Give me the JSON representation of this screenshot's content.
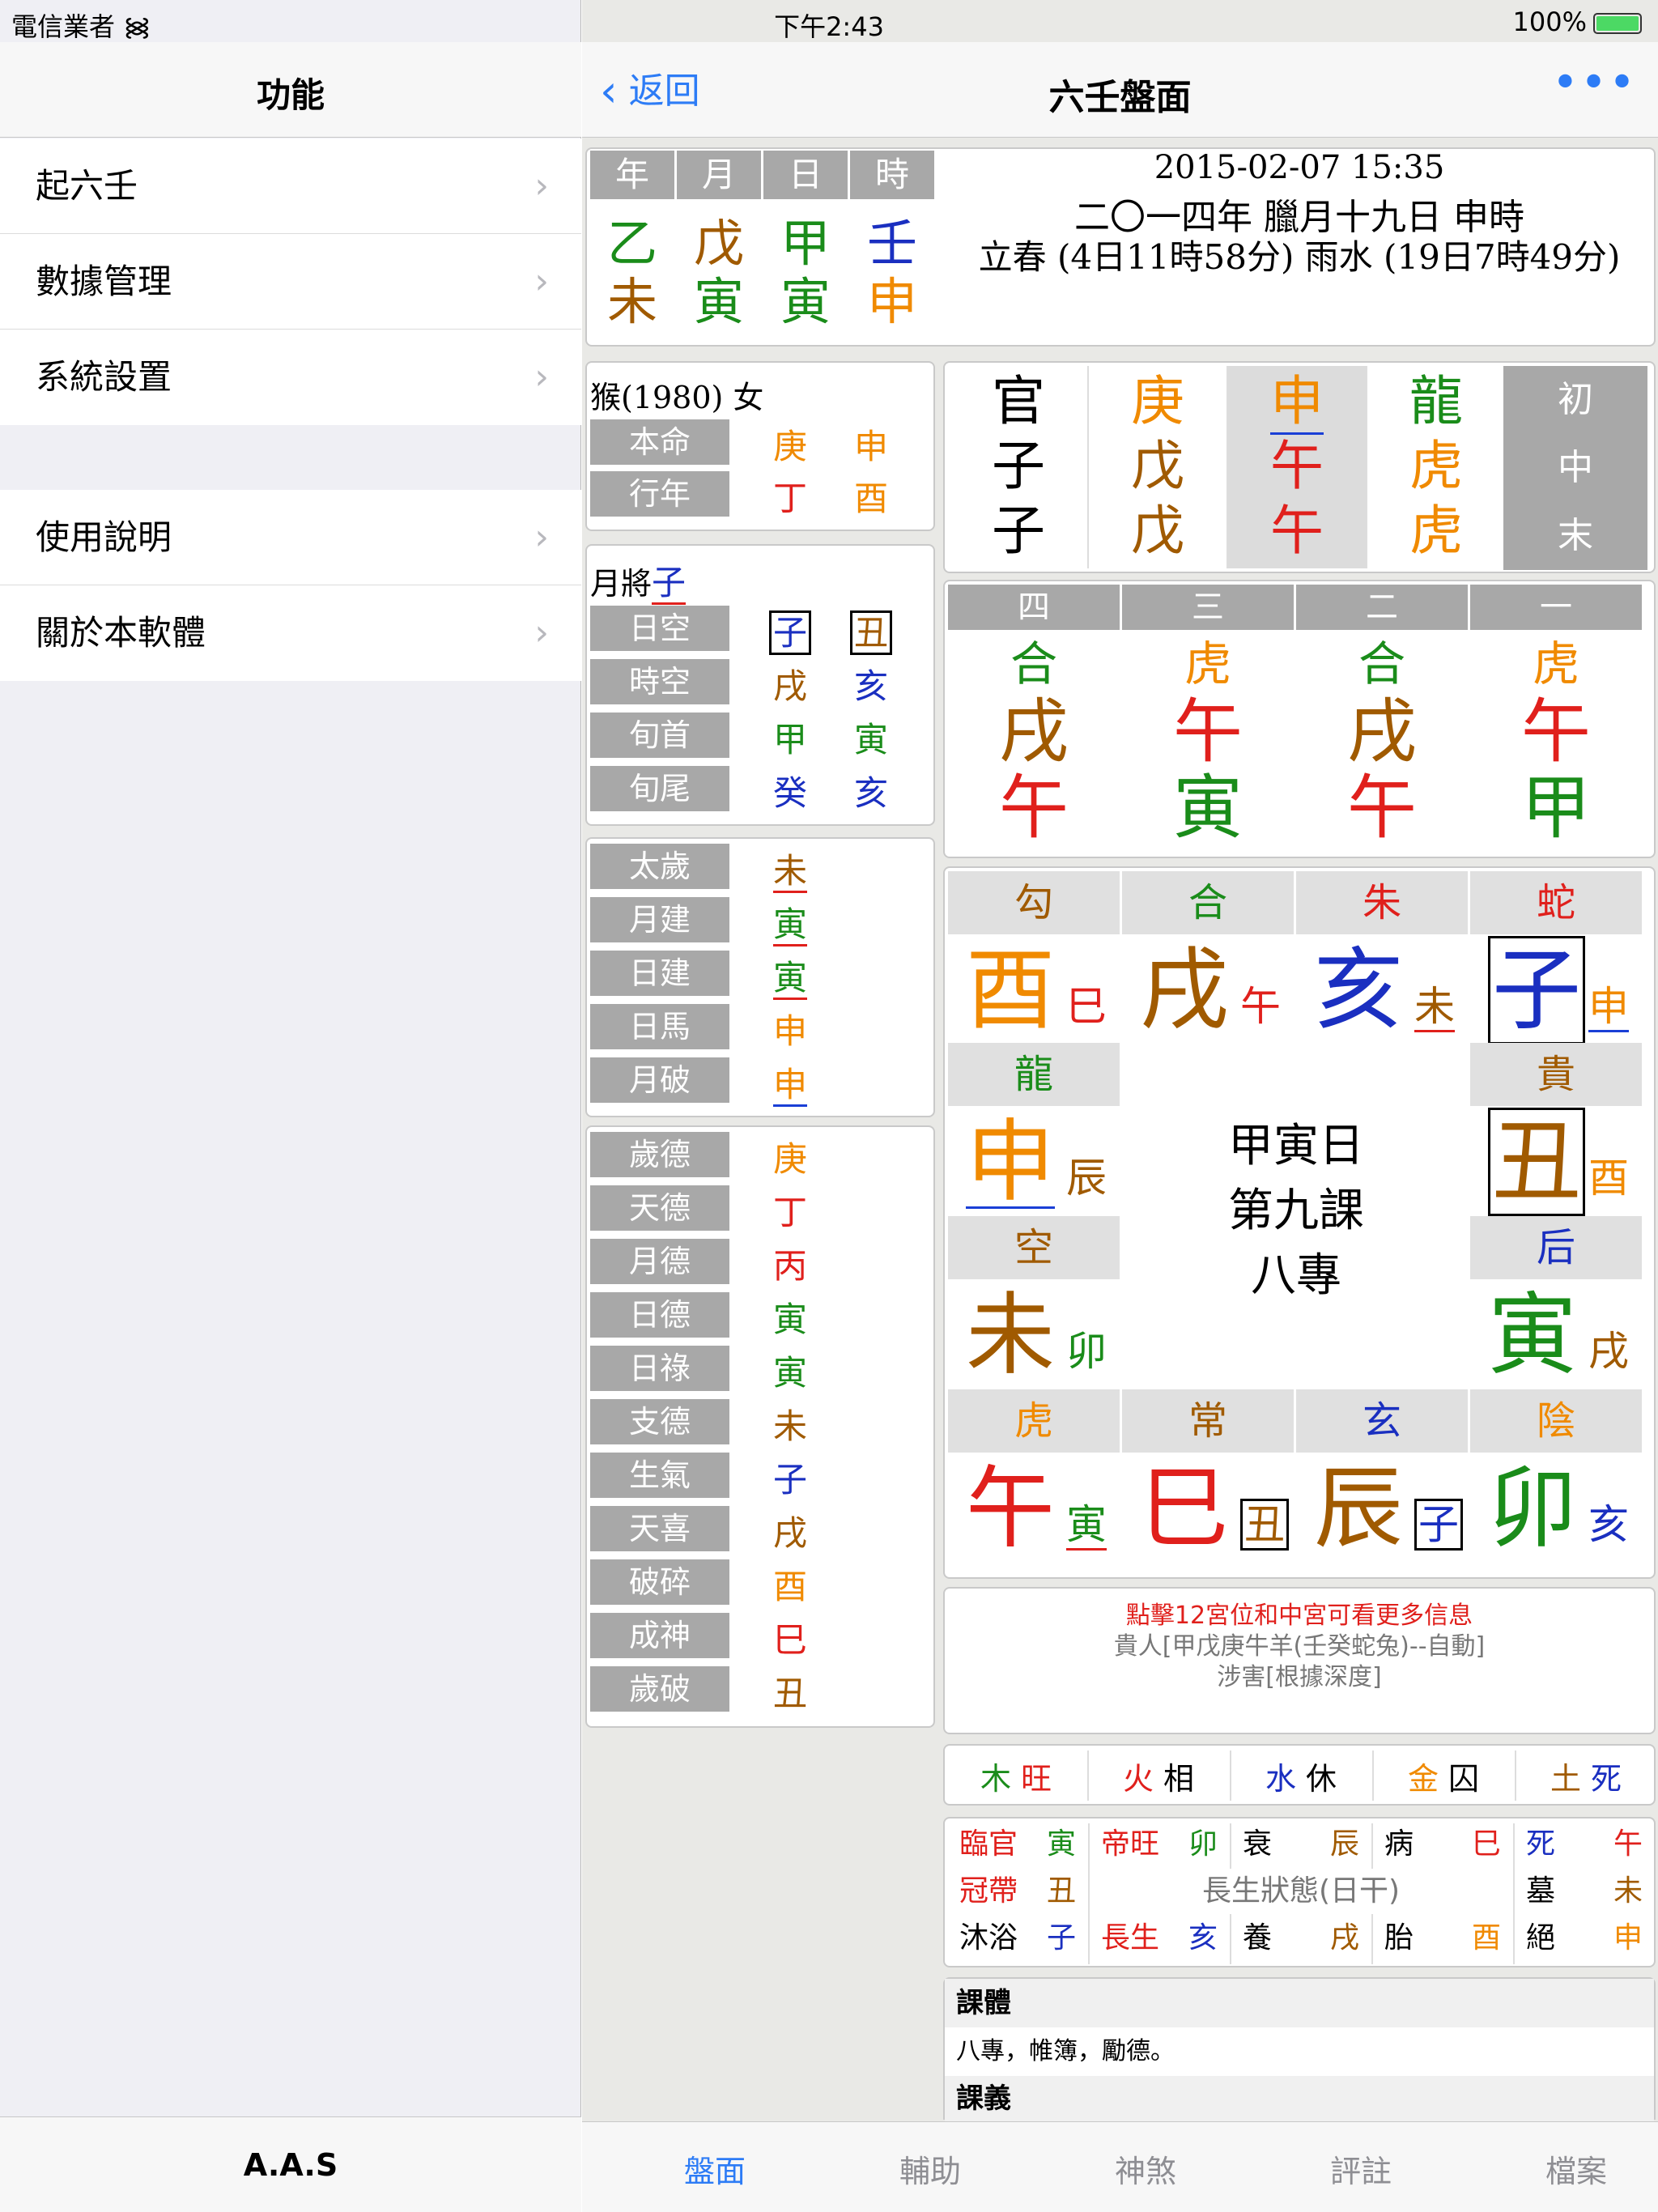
{
  "status": {
    "carrier": "電信業者",
    "time": "下午2:43",
    "battery": "100%"
  },
  "master": {
    "title": "功能",
    "group1": [
      {
        "label": "起六壬"
      },
      {
        "label": "數據管理"
      },
      {
        "label": "系統設置"
      }
    ],
    "group2": [
      {
        "label": "使用說明"
      },
      {
        "label": "關於本軟體"
      }
    ],
    "footer": "A.A.S"
  },
  "detail": {
    "back": "返回",
    "title": "六壬盤面",
    "more": "•••",
    "tabs": [
      "盤面",
      "輔助",
      "神煞",
      "評註",
      "檔案"
    ]
  },
  "pillars": {
    "headers": [
      "年",
      "月",
      "日",
      "時"
    ],
    "stems": [
      {
        "t": "乙",
        "c": "c-grn"
      },
      {
        "t": "戊",
        "c": "c-brn"
      },
      {
        "t": "甲",
        "c": "c-grn"
      },
      {
        "t": "壬",
        "c": "c-blu"
      }
    ],
    "branches": [
      {
        "t": "未",
        "c": "c-brn"
      },
      {
        "t": "寅",
        "c": "c-grn"
      },
      {
        "t": "寅",
        "c": "c-grn"
      },
      {
        "t": "申",
        "c": "c-ora"
      }
    ],
    "datetime": "2015-02-07 15:35",
    "lunar": "二〇一四年 臘月十九日 申時",
    "solar_terms": "立春 (4日11時58分) 雨水 (19日7時49分)"
  },
  "person": {
    "header": "猴(1980) 女",
    "rows": [
      {
        "label": "本命",
        "v1": "庚",
        "c1": "c-ora",
        "v2": "申",
        "c2": "c-ora"
      },
      {
        "label": "行年",
        "v1": "丁",
        "c1": "c-red",
        "v2": "酉",
        "c2": "c-ora"
      }
    ]
  },
  "yuejiang": {
    "label": "月將",
    "value": "子",
    "rows": [
      {
        "label": "日空",
        "v1": "子",
        "c1": "c-blu",
        "v2": "丑",
        "c2": "c-brn",
        "boxed": true
      },
      {
        "label": "時空",
        "v1": "戌",
        "c1": "c-brn",
        "v2": "亥",
        "c2": "c-blu"
      },
      {
        "label": "旬首",
        "v1": "甲",
        "c1": "c-grn",
        "v2": "寅",
        "c2": "c-grn"
      },
      {
        "label": "旬尾",
        "v1": "癸",
        "c1": "c-blu",
        "v2": "亥",
        "c2": "c-blu"
      }
    ]
  },
  "taisui": [
    {
      "label": "太歲",
      "v": "未",
      "c": "c-brn",
      "ul": "ul-r"
    },
    {
      "label": "月建",
      "v": "寅",
      "c": "c-grn",
      "ul": "ul-r"
    },
    {
      "label": "日建",
      "v": "寅",
      "c": "c-grn",
      "ul": "ul-r"
    },
    {
      "label": "日馬",
      "v": "申",
      "c": "c-ora",
      "ul": ""
    },
    {
      "label": "月破",
      "v": "申",
      "c": "c-ora",
      "ul": "ul-b"
    }
  ],
  "shensha": [
    {
      "label": "歲德",
      "v": "庚",
      "c": "c-ora"
    },
    {
      "label": "天德",
      "v": "丁",
      "c": "c-red"
    },
    {
      "label": "月德",
      "v": "丙",
      "c": "c-red"
    },
    {
      "label": "日德",
      "v": "寅",
      "c": "c-grn"
    },
    {
      "label": "日祿",
      "v": "寅",
      "c": "c-grn"
    },
    {
      "label": "支德",
      "v": "未",
      "c": "c-brn"
    },
    {
      "label": "生氣",
      "v": "子",
      "c": "c-blu"
    },
    {
      "label": "天喜",
      "v": "戌",
      "c": "c-brn"
    },
    {
      "label": "破碎",
      "v": "酉",
      "c": "c-ora"
    },
    {
      "label": "成神",
      "v": "巳",
      "c": "c-red"
    },
    {
      "label": "歲破",
      "v": "丑",
      "c": "c-brn"
    }
  ],
  "sanchuan": {
    "cols": [
      {
        "cells": [
          {
            "t": "官",
            "c": "c-blk"
          },
          {
            "t": "子",
            "c": "c-blk"
          },
          {
            "t": "子",
            "c": "c-blk"
          }
        ],
        "shade": false
      },
      {
        "cells": [
          {
            "t": "庚",
            "c": "c-ora"
          },
          {
            "t": "戊",
            "c": "c-brn"
          },
          {
            "t": "戊",
            "c": "c-brn"
          }
        ],
        "shade": false
      },
      {
        "cells": [
          {
            "t": "申",
            "c": "c-ora"
          },
          {
            "t": "午",
            "c": "c-red"
          },
          {
            "t": "午",
            "c": "c-red"
          }
        ],
        "shade": true
      },
      {
        "cells": [
          {
            "t": "龍",
            "c": "c-grn"
          },
          {
            "t": "虎",
            "c": "c-ora"
          },
          {
            "t": "虎",
            "c": "c-ora"
          }
        ],
        "shade": false
      }
    ],
    "labels": [
      "初",
      "中",
      "末"
    ]
  },
  "sike": {
    "headers": [
      "四",
      "三",
      "二",
      "一"
    ],
    "cols": [
      [
        {
          "t": "合",
          "c": "c-grn"
        },
        {
          "t": "戌",
          "c": "c-brn"
        },
        {
          "t": "午",
          "c": "c-red"
        }
      ],
      [
        {
          "t": "虎",
          "c": "c-ora"
        },
        {
          "t": "午",
          "c": "c-red"
        },
        {
          "t": "寅",
          "c": "c-grn"
        }
      ],
      [
        {
          "t": "合",
          "c": "c-grn"
        },
        {
          "t": "戌",
          "c": "c-brn"
        },
        {
          "t": "午",
          "c": "c-red"
        }
      ],
      [
        {
          "t": "虎",
          "c": "c-ora"
        },
        {
          "t": "午",
          "c": "c-red"
        },
        {
          "t": "甲",
          "c": "c-grn"
        }
      ]
    ]
  },
  "palace": {
    "top": [
      {
        "g": "勾",
        "gc": "c-brn",
        "b": "酉",
        "bc": "c-ora",
        "s": "巳",
        "sc": "c-red"
      },
      {
        "g": "合",
        "gc": "c-grn",
        "b": "戌",
        "bc": "c-brn",
        "s": "午",
        "sc": "c-red"
      },
      {
        "g": "朱",
        "gc": "c-red",
        "b": "亥",
        "bc": "c-blu",
        "s": "未",
        "sc": "c-brn"
      },
      {
        "g": "蛇",
        "gc": "c-red",
        "b": "子",
        "bc": "c-blu",
        "s": "申",
        "sc": "c-ora"
      }
    ],
    "bottom": [
      {
        "g": "虎",
        "gc": "c-ora",
        "b": "午",
        "bc": "c-red",
        "s": "寅",
        "sc": "c-grn"
      },
      {
        "g": "常",
        "gc": "c-brn",
        "b": "巳",
        "bc": "c-red",
        "s": "丑",
        "sc": "c-brn"
      },
      {
        "g": "玄",
        "gc": "c-blu",
        "b": "辰",
        "bc": "c-brn",
        "s": "子",
        "sc": "c-blu"
      },
      {
        "g": "陰",
        "gc": "c-ora",
        "b": "卯",
        "bc": "c-grn",
        "s": "亥",
        "sc": "c-blu"
      }
    ],
    "left": [
      {
        "g": "龍",
        "gc": "c-grn",
        "b": "申",
        "bc": "c-ora",
        "s": "辰",
        "sc": "c-brn"
      },
      {
        "g": "空",
        "gc": "c-brn",
        "b": "未",
        "bc": "c-brn",
        "s": "卯",
        "sc": "c-grn"
      }
    ],
    "right": [
      {
        "g": "貴",
        "gc": "c-brn",
        "b": "丑",
        "bc": "c-brn",
        "s": "酉",
        "sc": "c-ora"
      },
      {
        "g": "后",
        "gc": "c-blu",
        "b": "寅",
        "bc": "c-grn",
        "s": "戌",
        "sc": "c-brn"
      }
    ],
    "center": [
      "甲寅日",
      "第九課",
      "八專"
    ]
  },
  "notes": {
    "hint": "點擊12宮位和中宮可看更多信息",
    "line1": "貴人[甲戊庚牛羊(壬癸蛇兔)--自動]",
    "line2": "涉害[根據深度]"
  },
  "wuxing": [
    {
      "a": "木",
      "ac": "c-grn",
      "b": "旺",
      "bc": "c-red"
    },
    {
      "a": "火",
      "ac": "c-red",
      "b": "相",
      "bc": "c-blk"
    },
    {
      "a": "水",
      "ac": "c-blu",
      "b": "休",
      "bc": "c-blk"
    },
    {
      "a": "金",
      "ac": "c-ora",
      "b": "囚",
      "bc": "c-blk"
    },
    {
      "a": "土",
      "ac": "c-brn",
      "b": "死",
      "bc": "c-blu"
    }
  ],
  "changsheng": {
    "title": "長生狀態(日干)",
    "r1": [
      {
        "a": "臨官",
        "ac": "c-red",
        "b": "寅",
        "bc": "c-grn"
      },
      {
        "a": "帝旺",
        "ac": "c-red",
        "b": "卯",
        "bc": "c-grn"
      },
      {
        "a": "衰",
        "ac": "c-blk",
        "b": "辰",
        "bc": "c-brn"
      },
      {
        "a": "病",
        "ac": "c-blk",
        "b": "巳",
        "bc": "c-red"
      },
      {
        "a": "死",
        "ac": "c-blu",
        "b": "午",
        "bc": "c-red"
      }
    ],
    "r2l": {
      "a": "冠帶",
      "ac": "c-red",
      "b": "丑",
      "bc": "c-brn"
    },
    "r2r": {
      "a": "墓",
      "ac": "c-blk",
      "b": "未",
      "bc": "c-brn"
    },
    "r3": [
      {
        "a": "沐浴",
        "ac": "c-blk",
        "b": "子",
        "bc": "c-blu"
      },
      {
        "a": "長生",
        "ac": "c-red",
        "b": "亥",
        "bc": "c-blu"
      },
      {
        "a": "養",
        "ac": "c-blk",
        "b": "戌",
        "bc": "c-brn"
      },
      {
        "a": "胎",
        "ac": "c-blk",
        "b": "酉",
        "bc": "c-ora"
      },
      {
        "a": "絕",
        "ac": "c-blk",
        "b": "申",
        "bc": "c-ora"
      }
    ]
  },
  "keti": {
    "title": "課體",
    "text": "八專，帷簿，勵德。",
    "title2": "課義"
  }
}
